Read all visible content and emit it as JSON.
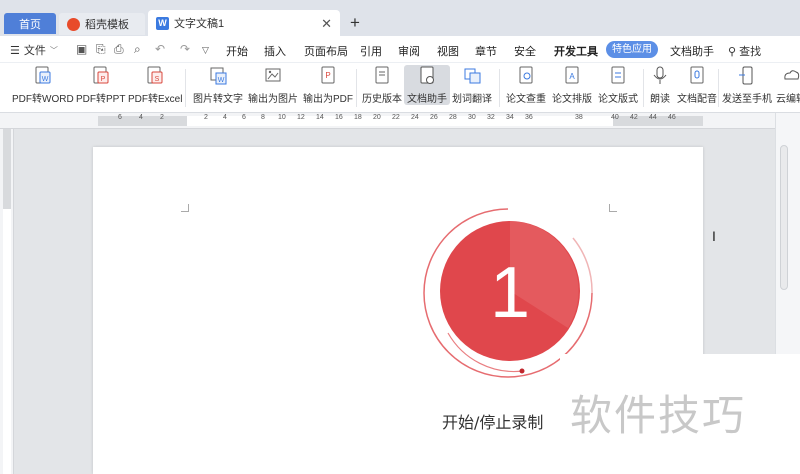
{
  "tabs": {
    "home": "首页",
    "daoke": "稻壳模板",
    "doc": "文字文稿1",
    "close": "✕",
    "add": "+"
  },
  "menu": {
    "file": "文件",
    "items": [
      "开始",
      "插入",
      "页面布局",
      "引用",
      "审阅",
      "视图",
      "章节",
      "安全",
      "开发工具"
    ],
    "active": "特色应用",
    "doc_helper": "文档助手",
    "search": "查找"
  },
  "ribbon": {
    "pdf_word": "PDF转WORD",
    "pdf_ppt": "PDF转PPT",
    "pdf_excel": "PDF转Excel",
    "img_text": "图片转文字",
    "export_img": "输出为图片",
    "export_pdf": "输出为PDF",
    "history": "历史版本",
    "doc_assistant": "文档助手",
    "translate": "划词翻译",
    "paper_check": "论文查重",
    "paper_layout": "论文排版",
    "paper_format": "论文版式",
    "read": "朗读",
    "dubbing": "文档配音",
    "send_phone": "发送至手机",
    "cloud": "云编辑"
  },
  "ruler": {
    "left_nums": [
      "6",
      "4",
      "2"
    ],
    "nums": [
      "2",
      "4",
      "6",
      "8",
      "10",
      "12",
      "14",
      "16",
      "18",
      "20",
      "22",
      "24",
      "26",
      "28",
      "30",
      "32",
      "34",
      "36",
      "38"
    ],
    "right_nums": [
      "40",
      "42",
      "44",
      "46"
    ]
  },
  "recorder": {
    "count": "1",
    "label": "开始/停止录制"
  },
  "watermark": "软件技巧",
  "colors": {
    "accent": "#4f7fd8",
    "record_red": "#e0474c"
  }
}
